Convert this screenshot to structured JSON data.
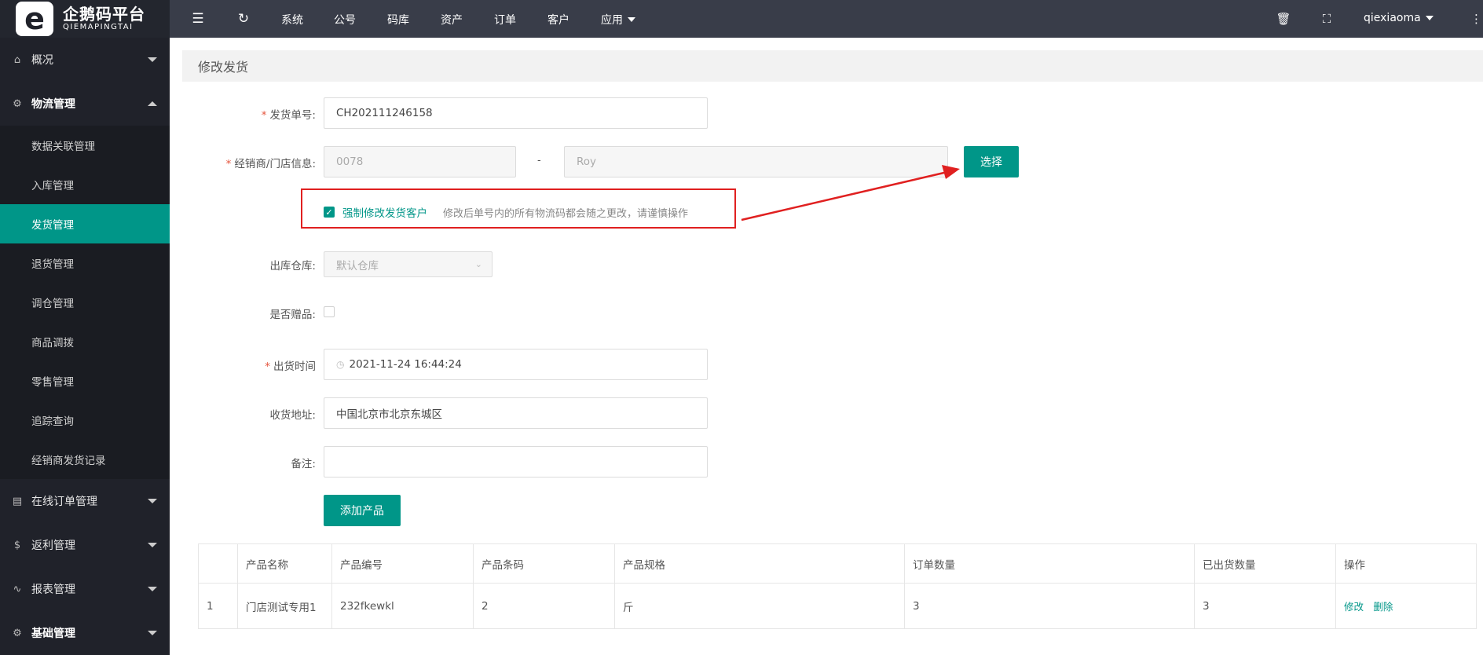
{
  "logo": {
    "mark": "e",
    "name_cn": "企鹅码平台",
    "name_en": "QIEMAPINGTAI"
  },
  "header": {
    "menu": [
      "系统",
      "公号",
      "码库",
      "资产",
      "订单",
      "客户",
      "应用"
    ],
    "user": "qiexiaoma",
    "icons": [
      "menu-fold-icon",
      "refresh-icon",
      "trash-icon",
      "fullscreen-icon"
    ]
  },
  "sidebar": {
    "groups": [
      {
        "label": "概况",
        "icon": "home-icon"
      },
      {
        "label": "物流管理",
        "icon": "gear-icon"
      },
      {
        "label": "在线订单管理",
        "icon": "clipboard-icon"
      },
      {
        "label": "返利管理",
        "icon": "dollar-icon"
      },
      {
        "label": "报表管理",
        "icon": "pulse-icon"
      },
      {
        "label": "基础管理",
        "icon": "gear-icon"
      }
    ],
    "sub_items": [
      "数据关联管理",
      "入库管理",
      "发货管理",
      "退货管理",
      "调仓管理",
      "商品调拨",
      "零售管理",
      "追踪查询",
      "经销商发货记录"
    ],
    "active": "发货管理"
  },
  "page": {
    "title": "修改发货"
  },
  "form": {
    "ship_no": {
      "label": "发货单号:",
      "value": "CH202111246158"
    },
    "dealer": {
      "label": "经销商/门店信息:",
      "code": "0078",
      "separator": "-",
      "name": "Roy",
      "select_button": "选择"
    },
    "force_change": {
      "label": "强制修改发货客户",
      "hint": "修改后单号内的所有物流码都会随之更改，请谨慎操作",
      "checked": true
    },
    "warehouse": {
      "label": "出库仓库:",
      "placeholder": "默认仓库"
    },
    "gift": {
      "label": "是否赠品:"
    },
    "ship_time": {
      "label": "出货时间",
      "value": "2021-11-24 16:44:24"
    },
    "address": {
      "label": "收货地址:",
      "value": "中国北京市北京东城区"
    },
    "remark": {
      "label": "备注:",
      "value": ""
    },
    "add_product": "添加产品"
  },
  "table": {
    "headers": [
      "",
      "产品名称",
      "产品编号",
      "产品条码",
      "产品规格",
      "订单数量",
      "已出货数量",
      "操作"
    ],
    "rows": [
      {
        "index": "1",
        "name": "门店测试专用1",
        "code": "232fkewkl",
        "barcode": "2",
        "spec": "斤",
        "order_qty": "3",
        "shipped_qty": "3",
        "edit": "修改",
        "delete": "删除"
      }
    ]
  },
  "colors": {
    "accent": "#009688",
    "sidebar": "#20222a",
    "header": "#393d49",
    "highlight_box": "#e02020"
  }
}
